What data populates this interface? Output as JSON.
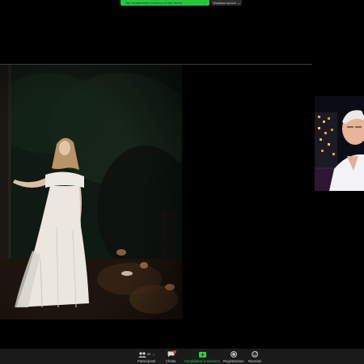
{
  "banner": {
    "sharing_text": "Stai visualizzando lo schermo di Vito Storno",
    "view_options_label": "Visualizza opzioni"
  },
  "toolbar": {
    "participants": {
      "label": "Partecipanti",
      "count": "65"
    },
    "chat": {
      "label": "Chatta"
    },
    "share": {
      "label": "Condividere lo schermo"
    },
    "record": {
      "label": "Registrazione"
    },
    "reactions": {
      "label": "Reazioni"
    }
  },
  "colors": {
    "share_green": "#27c63f",
    "toolbar_bg": "#1a1a1a",
    "chat_badge": "#e0332f"
  },
  "icons": [
    "participants-icon",
    "chat-icon",
    "share-screen-icon",
    "record-icon",
    "reactions-icon"
  ]
}
